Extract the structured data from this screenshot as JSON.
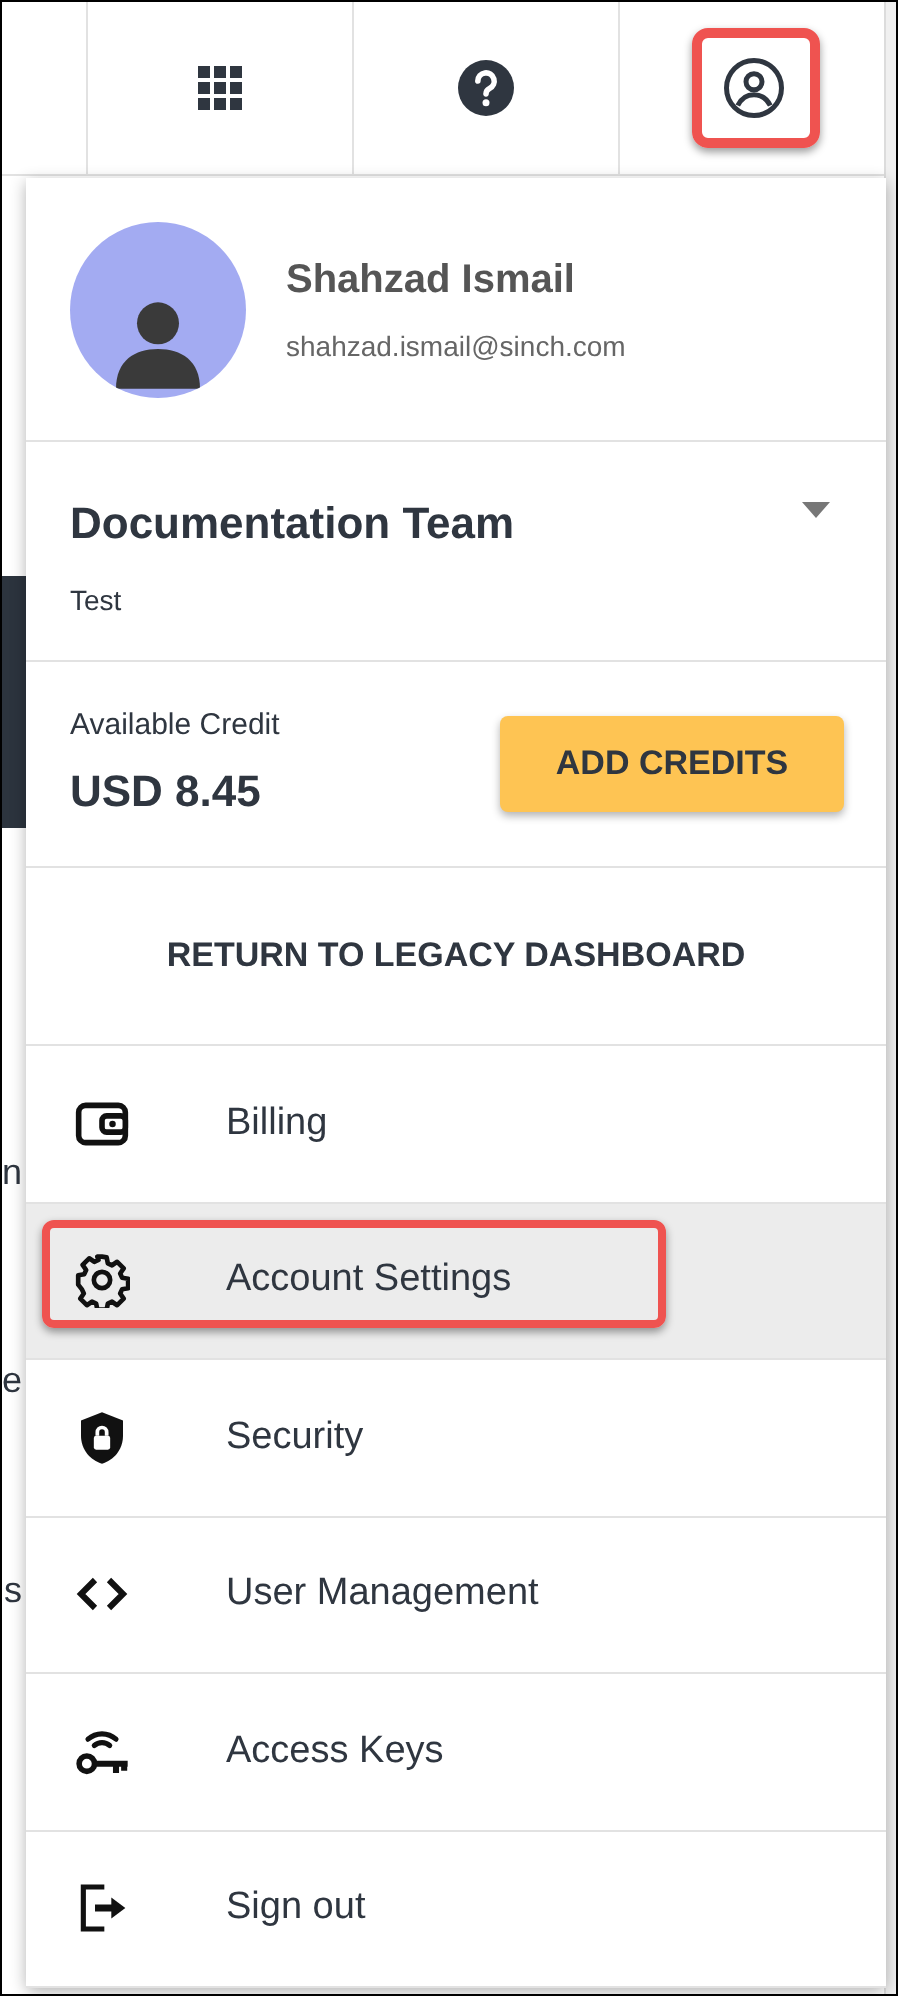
{
  "top_bar": {
    "buttons": [
      {
        "kind": "apps",
        "annotated": false
      },
      {
        "kind": "help",
        "annotated": false
      },
      {
        "kind": "profile",
        "annotated": true
      }
    ]
  },
  "background_fragments": [
    "n",
    "e",
    "s"
  ],
  "profile_menu": {
    "user": {
      "name": "Shahzad Ismail",
      "email": "shahzad.ismail@sinch.com"
    },
    "team": {
      "name": "Documentation Team",
      "subtitle": "Test"
    },
    "credit": {
      "label": "Available Credit",
      "amount": "USD 8.45",
      "button": "ADD CREDITS"
    },
    "legacy_link": "RETURN TO LEGACY DASHBOARD",
    "items": [
      {
        "kind": "billing",
        "label": "Billing",
        "selected": false,
        "annotated": false
      },
      {
        "kind": "settings",
        "label": "Account Settings",
        "selected": true,
        "annotated": true
      },
      {
        "kind": "security",
        "label": "Security",
        "selected": false,
        "annotated": false
      },
      {
        "kind": "users",
        "label": "User Management",
        "selected": false,
        "annotated": false
      },
      {
        "kind": "keys",
        "label": "Access Keys",
        "selected": false,
        "annotated": false
      },
      {
        "kind": "signout",
        "label": "Sign out",
        "selected": false,
        "annotated": false
      }
    ]
  }
}
